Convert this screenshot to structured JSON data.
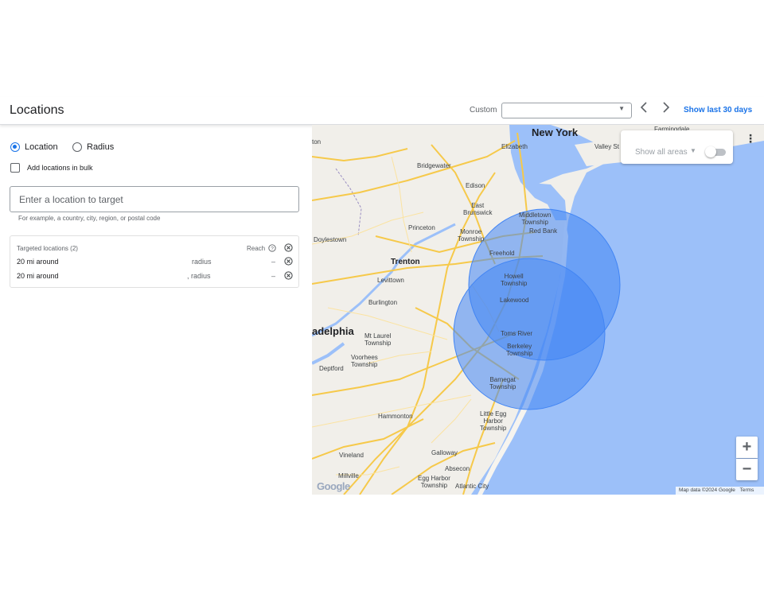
{
  "header": {
    "title": "Locations",
    "range_label": "Custom",
    "range_value": "",
    "show_last_label": "Show last 30 days"
  },
  "left": {
    "mode_options": [
      {
        "label": "Location",
        "selected": true
      },
      {
        "label": "Radius",
        "selected": false
      }
    ],
    "bulk_label": "Add locations in bulk",
    "search": {
      "placeholder": "Enter a location to target",
      "value": ""
    },
    "helper": "For example, a country, city, region, or postal code",
    "targets": {
      "header": "Targeted locations (2)",
      "reach_header": "Reach",
      "rows": [
        {
          "name": "20 mi around",
          "type": "radius",
          "reach": "–"
        },
        {
          "name": "20 mi around",
          "type": ", radius",
          "reach": "–"
        }
      ]
    }
  },
  "map": {
    "show_all_areas": "Show all areas",
    "attribution": "Map data ©2024 Google",
    "terms": "Terms",
    "logo": "Google",
    "zoom_in": "+",
    "zoom_out": "−",
    "more": "⋮",
    "labels": {
      "new_york": "New York",
      "elizabeth": "Elizabeth",
      "valley_st": "Valley St",
      "bridgewater": "Bridgewater",
      "edison": "Edison",
      "east_brunswick": "East\nBrunswick",
      "middletown": "Middletown\nTownship",
      "red_bank": "Red Bank",
      "princeton": "Princeton",
      "monroe": "Monroe\nTownship",
      "doylestown": "Doylestown",
      "trenton": "Trenton",
      "freehold": "Freehold",
      "levittown": "Levittown",
      "howell": "Howell\nTownship",
      "lakewood": "Lakewood",
      "burlington": "Burlington",
      "philadelphia": "adelphia",
      "mt_laurel": "Mt Laurel\nTownship",
      "toms_river": "Toms River",
      "berkeley": "Berkeley\nTownship",
      "voorhees": "Voorhees\nTownship",
      "deptford": "Deptford",
      "barnegat": "Barnegat\nTownship",
      "hammonton": "Hammonton",
      "little_egg": "Little Egg\nHarbor\nTownship",
      "vineland": "Vineland",
      "galloway": "Galloway",
      "absecon": "Absecon",
      "millville": "Millville",
      "egg_harbor": "Egg Harbor\nTownship",
      "atlantic_city": "Atlantic City",
      "farmingdale": "Farmingdale",
      "ton": "ton"
    }
  },
  "colors": {
    "accent": "#1a73e8",
    "radius_fill": "#4285f4",
    "water": "#9cc0f9",
    "land": "#f1efea",
    "road": "#f6c94a"
  }
}
